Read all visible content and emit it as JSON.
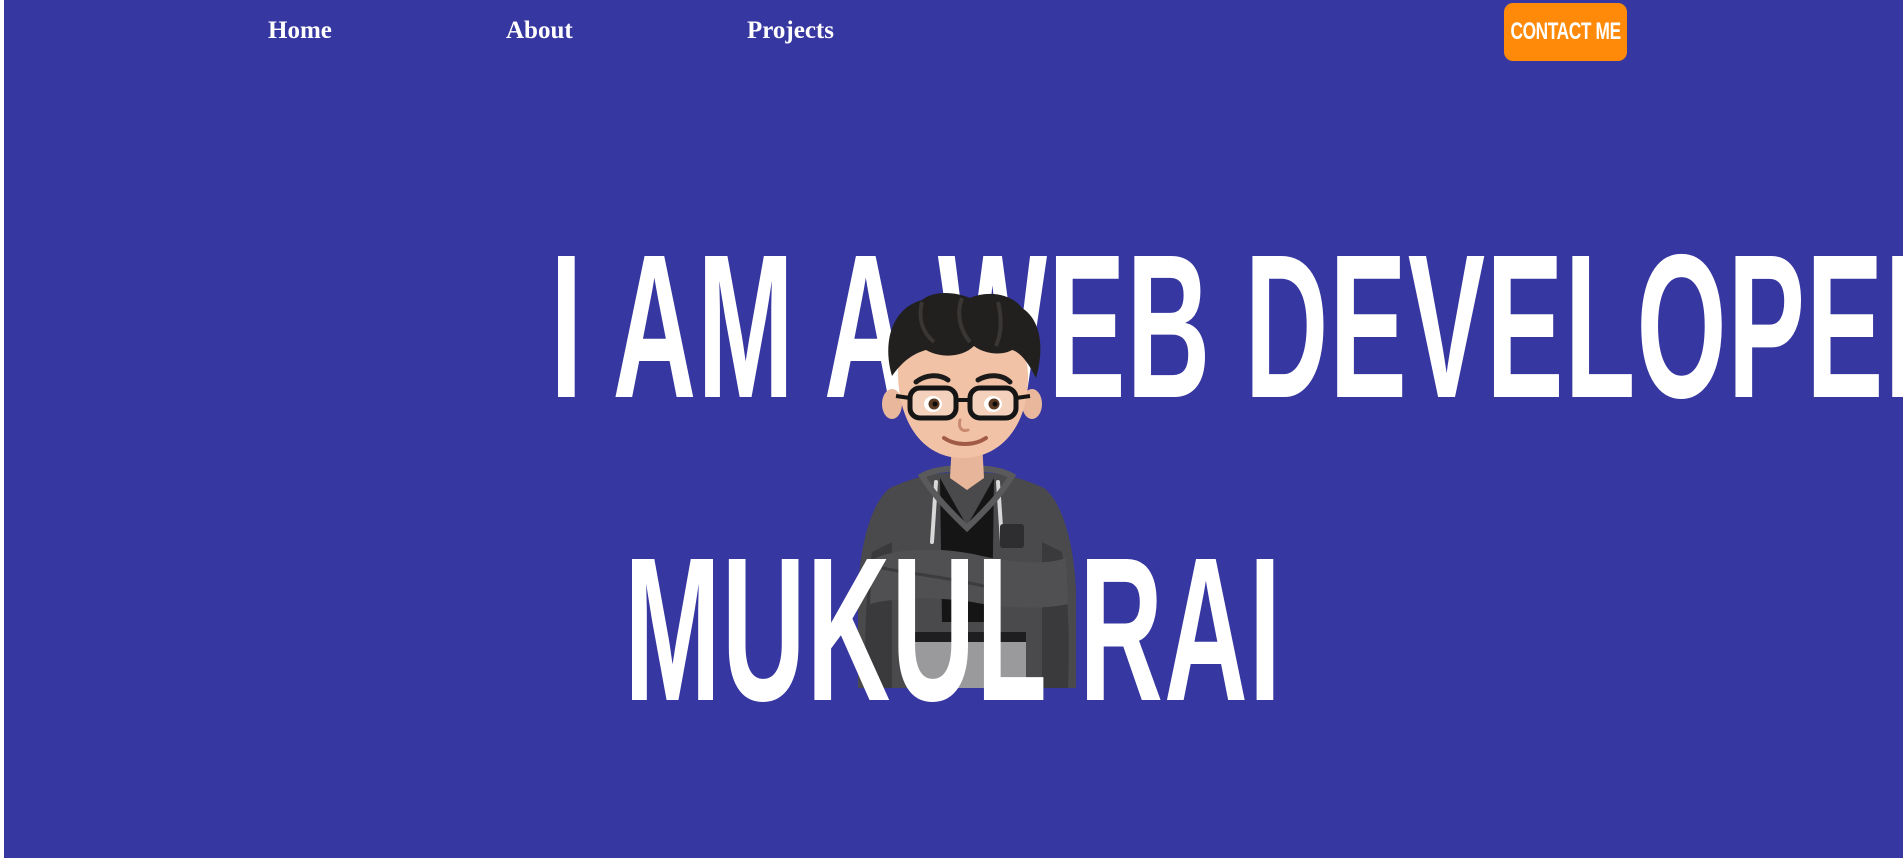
{
  "nav": {
    "home": "Home",
    "about": "About",
    "projects": "Projects",
    "contact": "CONTACT ME"
  },
  "hero": {
    "line1": "I AM A WEB DEVELOPER",
    "line2": "MUKUL RAI"
  },
  "colors": {
    "background": "#3637a0",
    "accent": "#ff8a0a",
    "text": "#ffffff"
  }
}
